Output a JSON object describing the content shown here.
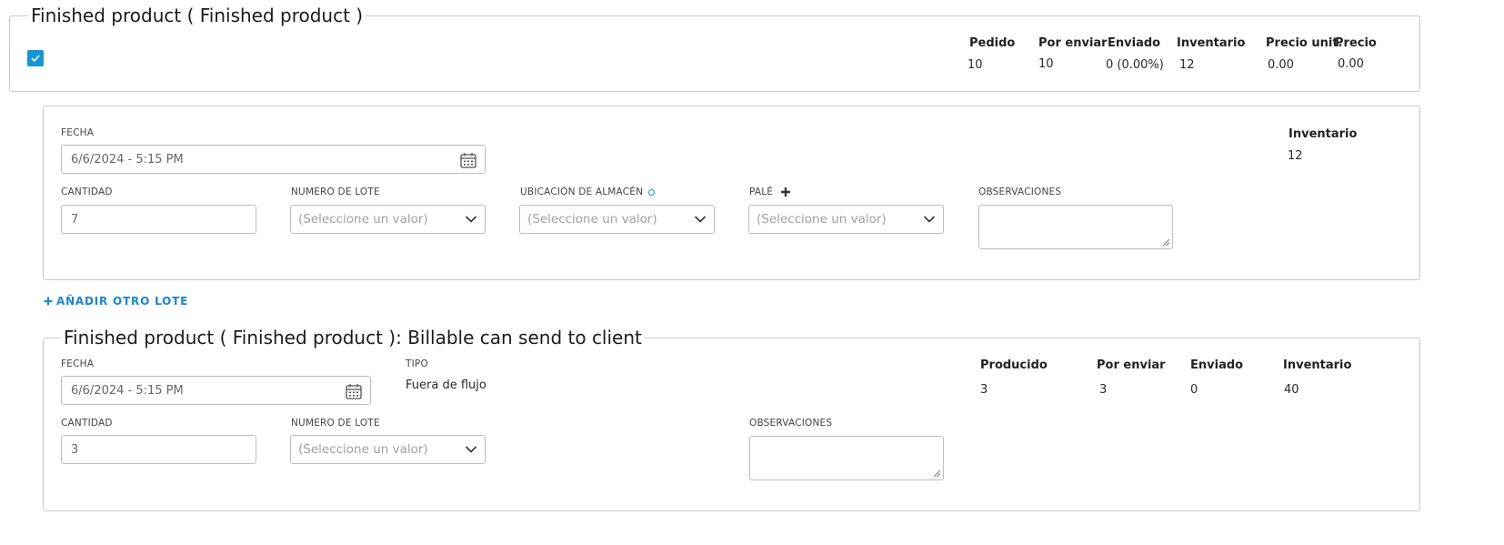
{
  "section1": {
    "legend": "Finished product ( Finished product )",
    "columns": [
      "Pedido",
      "Por enviar",
      "Enviado",
      "Inventario",
      "Precio unit.",
      "Precio"
    ],
    "values": [
      "10",
      "10",
      "0 (0.00%)",
      "12",
      "0.00",
      "0.00"
    ],
    "checkbox_checked": true
  },
  "lot_card": {
    "fecha_label": "FECHA",
    "fecha_value": "6/6/2024 - 5:15 PM",
    "inventario_label": "Inventario",
    "inventario_value": "12",
    "cantidad_label": "CANTIDAD",
    "cantidad_value": "7",
    "lote_label": "NUMERO DE LOTE",
    "lote_placeholder": "(Seleccione un valor)",
    "ubicacion_label": "UBICACIÓN DE ALMACÉN",
    "ubicacion_placeholder": "(Seleccione un valor)",
    "pale_label": "PALÉ",
    "pale_placeholder": "(Seleccione un valor)",
    "observaciones_label": "OBSERVACIONES"
  },
  "add_lot_label": "AÑADIR OTRO LOTE",
  "section2": {
    "legend": "Finished product ( Finished product ): Billable can send to client",
    "fecha_label": "FECHA",
    "fecha_value": "6/6/2024 - 5:15 PM",
    "tipo_label": "TIPO",
    "tipo_value": "Fuera de flujo",
    "columns": [
      "Producido",
      "Por enviar",
      "Enviado",
      "Inventario"
    ],
    "values": [
      "3",
      "3",
      "0",
      "40"
    ],
    "cantidad_label": "CANTIDAD",
    "cantidad_value": "3",
    "lote_label": "NUMERO DE LOTE",
    "lote_placeholder": "(Seleccione un valor)",
    "observaciones_label": "OBSERVACIONES"
  },
  "colors": {
    "accent": "#1596d4",
    "link": "#1b86c8",
    "border": "#c9c9c9"
  }
}
